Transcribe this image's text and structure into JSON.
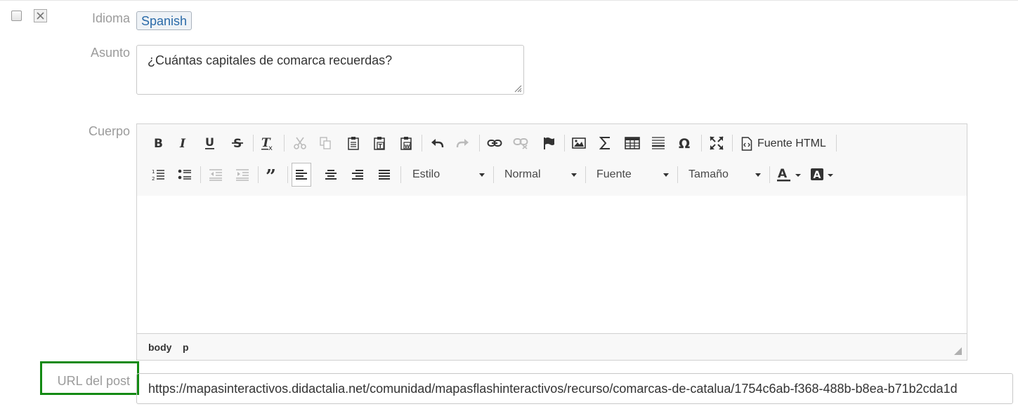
{
  "row": {
    "idioma_label": "Idioma",
    "idioma_value": "Spanish",
    "asunto_label": "Asunto",
    "asunto_value": "¿Cuántas capitales de comarca recuerdas?",
    "cuerpo_label": "Cuerpo",
    "url_label": "URL del post",
    "url_value": "https://mapasinteractivos.didactalia.net/comunidad/mapasflashinteractivos/recurso/comarcas-de-catalua/1754c6ab-f368-488b-b8ea-b71b2cda1d"
  },
  "editor": {
    "source_label": "Fuente HTML",
    "combos": {
      "estilo": "Estilo",
      "formato": "Normal",
      "fuente": "Fuente",
      "tamano": "Tamaño"
    },
    "status_path": [
      "body",
      "p"
    ]
  },
  "colors": {
    "highlight_border": "#138a13",
    "link_blue": "#2a6aa8",
    "label_gray": "#9b9b9b"
  }
}
